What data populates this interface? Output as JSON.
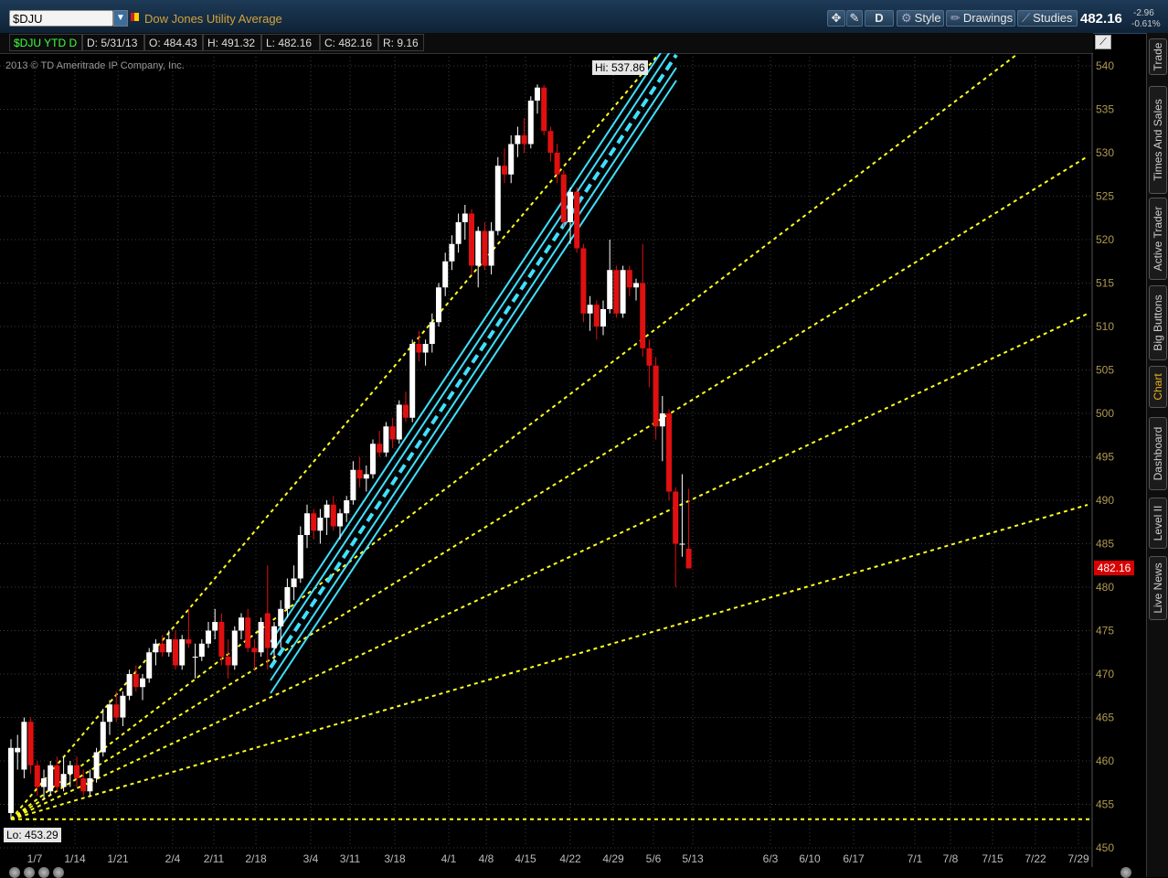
{
  "header": {
    "symbol": "$DJU",
    "description": "Dow Jones Utility Average",
    "style_label": "Style",
    "drawings_label": "Drawings",
    "studies_label": "Studies",
    "aggregation_label": "D",
    "last_price": "482.16",
    "net_change": "-2.96",
    "pct_change": "-0.61%"
  },
  "infobar": {
    "symbol_period": "$DJU YTD D",
    "date": "D: 5/31/13",
    "open": "O: 484.43",
    "high": "H: 491.32",
    "low": "L: 482.16",
    "close": "C: 482.16",
    "range": "R: 9.16"
  },
  "copyright": "2013 © TD Ameritrade IP Company, Inc.",
  "sidebar_tabs": [
    "Trade",
    "Times And Sales",
    "Active Trader",
    "Big Buttons",
    "Chart",
    "Dashboard",
    "Level II",
    "Live News"
  ],
  "active_tab": "Chart",
  "colors": {
    "background": "#000000",
    "up_candle": "#ffffff",
    "down_candle": "#e01010",
    "grid": "#3c3c3c",
    "fan_lines": "#ffff20",
    "channel": "#40e0ff",
    "price_axis_text": "#b09a50"
  },
  "chart_data": {
    "type": "candlestick",
    "symbol": "$DJU",
    "period": "YTD",
    "aggregation": "D",
    "y_range": [
      450,
      541
    ],
    "y_ticks": [
      450,
      455,
      460,
      465,
      470,
      475,
      480,
      485,
      490,
      495,
      500,
      505,
      510,
      515,
      520,
      525,
      530,
      535,
      540
    ],
    "x_ticks": [
      "1/7",
      "1/14",
      "1/21",
      "2/4",
      "2/11",
      "2/18",
      "3/4",
      "3/11",
      "3/18",
      "4/1",
      "4/8",
      "4/15",
      "4/22",
      "4/29",
      "5/6",
      "5/13",
      "6/3",
      "6/10",
      "6/17",
      "7/1",
      "7/8",
      "7/15",
      "7/22",
      "7/29"
    ],
    "hi_label": "Hi: 537.86",
    "lo_label": "Lo: 453.29",
    "last_price": "482.16",
    "hi": 537.86,
    "lo": 453.29,
    "candles": [
      {
        "date": "1/2",
        "o": 454.0,
        "h": 462.5,
        "l": 453.29,
        "c": 461.5
      },
      {
        "date": "1/3",
        "o": 461.0,
        "h": 463.0,
        "l": 459.0,
        "c": 461.5
      },
      {
        "date": "1/4",
        "o": 459.0,
        "h": 465.0,
        "l": 458.0,
        "c": 464.5
      },
      {
        "date": "1/7",
        "o": 464.5,
        "h": 465.0,
        "l": 458.5,
        "c": 459.5
      },
      {
        "date": "1/8",
        "o": 459.5,
        "h": 460.0,
        "l": 456.0,
        "c": 457.0
      },
      {
        "date": "1/9",
        "o": 457.0,
        "h": 459.0,
        "l": 455.5,
        "c": 458.0
      },
      {
        "date": "1/10",
        "o": 456.5,
        "h": 460.0,
        "l": 456.0,
        "c": 459.5
      },
      {
        "date": "1/11",
        "o": 459.5,
        "h": 460.5,
        "l": 456.5,
        "c": 457.0
      },
      {
        "date": "1/14",
        "o": 457.0,
        "h": 460.5,
        "l": 456.5,
        "c": 458.5
      },
      {
        "date": "1/15",
        "o": 458.5,
        "h": 460.0,
        "l": 457.0,
        "c": 459.5
      },
      {
        "date": "1/16",
        "o": 459.5,
        "h": 460.5,
        "l": 457.0,
        "c": 458.0
      },
      {
        "date": "1/17",
        "o": 458.0,
        "h": 459.0,
        "l": 456.0,
        "c": 456.5
      },
      {
        "date": "1/18",
        "o": 456.5,
        "h": 459.0,
        "l": 456.0,
        "c": 458.0
      },
      {
        "date": "1/22",
        "o": 458.0,
        "h": 461.5,
        "l": 457.5,
        "c": 461.0
      },
      {
        "date": "1/23",
        "o": 461.0,
        "h": 466.0,
        "l": 460.5,
        "c": 464.5
      },
      {
        "date": "1/24",
        "o": 464.5,
        "h": 467.0,
        "l": 463.0,
        "c": 466.5
      },
      {
        "date": "1/25",
        "o": 466.5,
        "h": 468.0,
        "l": 464.5,
        "c": 465.0
      },
      {
        "date": "1/28",
        "o": 465.0,
        "h": 468.0,
        "l": 464.0,
        "c": 467.5
      },
      {
        "date": "1/29",
        "o": 467.5,
        "h": 470.5,
        "l": 467.0,
        "c": 470.0
      },
      {
        "date": "1/30",
        "o": 470.0,
        "h": 471.0,
        "l": 468.0,
        "c": 468.5
      },
      {
        "date": "1/31",
        "o": 468.5,
        "h": 470.0,
        "l": 467.0,
        "c": 469.5
      },
      {
        "date": "2/1",
        "o": 469.5,
        "h": 473.0,
        "l": 469.0,
        "c": 472.5
      },
      {
        "date": "2/4",
        "o": 472.5,
        "h": 474.0,
        "l": 471.0,
        "c": 473.5
      },
      {
        "date": "2/5",
        "o": 473.5,
        "h": 474.5,
        "l": 472.0,
        "c": 472.5
      },
      {
        "date": "2/6",
        "o": 472.5,
        "h": 475.0,
        "l": 472.0,
        "c": 474.0
      },
      {
        "date": "2/7",
        "o": 474.0,
        "h": 475.0,
        "l": 470.5,
        "c": 471.0
      },
      {
        "date": "2/8",
        "o": 471.0,
        "h": 474.5,
        "l": 470.5,
        "c": 474.0
      },
      {
        "date": "2/11",
        "o": 474.0,
        "h": 477.5,
        "l": 473.0,
        "c": 473.5
      },
      {
        "date": "2/12",
        "o": 472.0,
        "h": 473.5,
        "l": 469.5,
        "c": 472.0
      },
      {
        "date": "2/13",
        "o": 472.0,
        "h": 474.0,
        "l": 471.5,
        "c": 473.5
      },
      {
        "date": "2/14",
        "o": 473.5,
        "h": 476.0,
        "l": 473.0,
        "c": 475.0
      },
      {
        "date": "2/15",
        "o": 475.0,
        "h": 477.5,
        "l": 474.0,
        "c": 476.0
      },
      {
        "date": "2/19",
        "o": 476.0,
        "h": 477.0,
        "l": 471.0,
        "c": 472.0
      },
      {
        "date": "2/20",
        "o": 472.0,
        "h": 474.0,
        "l": 469.5,
        "c": 471.0
      },
      {
        "date": "2/21",
        "o": 471.0,
        "h": 475.5,
        "l": 470.5,
        "c": 475.0
      },
      {
        "date": "2/22",
        "o": 475.0,
        "h": 477.0,
        "l": 474.0,
        "c": 476.5
      },
      {
        "date": "2/25",
        "o": 476.5,
        "h": 477.5,
        "l": 472.5,
        "c": 473.0
      },
      {
        "date": "2/26",
        "o": 473.0,
        "h": 474.0,
        "l": 470.5,
        "c": 472.5
      },
      {
        "date": "2/27",
        "o": 472.5,
        "h": 476.5,
        "l": 472.0,
        "c": 476.0
      },
      {
        "date": "2/28",
        "o": 477.0,
        "h": 482.5,
        "l": 470.5,
        "c": 473.0
      },
      {
        "date": "3/1",
        "o": 473.0,
        "h": 476.0,
        "l": 471.5,
        "c": 475.5
      },
      {
        "date": "3/4",
        "o": 475.5,
        "h": 478.5,
        "l": 473.0,
        "c": 477.5
      },
      {
        "date": "3/5",
        "o": 477.5,
        "h": 481.0,
        "l": 476.5,
        "c": 480.0
      },
      {
        "date": "3/6",
        "o": 480.0,
        "h": 482.5,
        "l": 478.5,
        "c": 481.0
      },
      {
        "date": "3/7",
        "o": 481.0,
        "h": 487.0,
        "l": 480.5,
        "c": 486.0
      },
      {
        "date": "3/8",
        "o": 486.0,
        "h": 489.5,
        "l": 484.5,
        "c": 488.5
      },
      {
        "date": "3/11",
        "o": 488.5,
        "h": 489.0,
        "l": 485.5,
        "c": 486.5
      },
      {
        "date": "3/12",
        "o": 486.5,
        "h": 489.0,
        "l": 485.0,
        "c": 488.0
      },
      {
        "date": "3/13",
        "o": 488.0,
        "h": 490.0,
        "l": 486.0,
        "c": 489.5
      },
      {
        "date": "3/14",
        "o": 489.5,
        "h": 490.5,
        "l": 486.5,
        "c": 487.0
      },
      {
        "date": "3/15",
        "o": 487.0,
        "h": 489.0,
        "l": 485.5,
        "c": 488.5
      },
      {
        "date": "3/18",
        "o": 488.5,
        "h": 490.5,
        "l": 487.5,
        "c": 490.0
      },
      {
        "date": "3/19",
        "o": 490.0,
        "h": 494.5,
        "l": 489.5,
        "c": 493.5
      },
      {
        "date": "3/20",
        "o": 493.5,
        "h": 495.0,
        "l": 491.5,
        "c": 492.5
      },
      {
        "date": "3/21",
        "o": 492.5,
        "h": 494.0,
        "l": 491.0,
        "c": 493.0
      },
      {
        "date": "3/22",
        "o": 493.0,
        "h": 497.0,
        "l": 492.5,
        "c": 496.5
      },
      {
        "date": "3/25",
        "o": 496.5,
        "h": 498.0,
        "l": 495.0,
        "c": 495.5
      },
      {
        "date": "3/26",
        "o": 495.5,
        "h": 499.0,
        "l": 495.0,
        "c": 498.5
      },
      {
        "date": "3/27",
        "o": 498.5,
        "h": 499.5,
        "l": 496.0,
        "c": 497.0
      },
      {
        "date": "3/28",
        "o": 497.0,
        "h": 501.5,
        "l": 496.5,
        "c": 501.0
      },
      {
        "date": "4/1",
        "o": 501.0,
        "h": 502.5,
        "l": 499.0,
        "c": 499.5
      },
      {
        "date": "4/2",
        "o": 499.5,
        "h": 508.5,
        "l": 499.0,
        "c": 508.0
      },
      {
        "date": "4/3",
        "o": 508.0,
        "h": 509.5,
        "l": 506.0,
        "c": 507.0
      },
      {
        "date": "4/4",
        "o": 507.0,
        "h": 508.5,
        "l": 505.5,
        "c": 508.0
      },
      {
        "date": "4/5",
        "o": 508.0,
        "h": 511.5,
        "l": 507.0,
        "c": 510.5
      },
      {
        "date": "4/8",
        "o": 510.5,
        "h": 515.0,
        "l": 510.0,
        "c": 514.5
      },
      {
        "date": "4/9",
        "o": 514.5,
        "h": 518.5,
        "l": 513.5,
        "c": 517.5
      },
      {
        "date": "4/10",
        "o": 517.5,
        "h": 520.5,
        "l": 516.5,
        "c": 519.5
      },
      {
        "date": "4/11",
        "o": 519.5,
        "h": 523.0,
        "l": 518.5,
        "c": 522.0
      },
      {
        "date": "4/12",
        "o": 522.0,
        "h": 524.0,
        "l": 520.0,
        "c": 523.0
      },
      {
        "date": "4/15",
        "o": 523.0,
        "h": 523.5,
        "l": 516.0,
        "c": 517.0
      },
      {
        "date": "4/16",
        "o": 517.0,
        "h": 521.5,
        "l": 514.5,
        "c": 521.0
      },
      {
        "date": "4/17",
        "o": 521.0,
        "h": 522.0,
        "l": 516.5,
        "c": 517.0
      },
      {
        "date": "4/18",
        "o": 517.0,
        "h": 522.0,
        "l": 516.0,
        "c": 521.0
      },
      {
        "date": "4/19",
        "o": 521.0,
        "h": 529.5,
        "l": 520.5,
        "c": 528.5
      },
      {
        "date": "4/22",
        "o": 528.5,
        "h": 530.5,
        "l": 526.5,
        "c": 527.5
      },
      {
        "date": "4/23",
        "o": 527.5,
        "h": 532.0,
        "l": 526.5,
        "c": 531.0
      },
      {
        "date": "4/24",
        "o": 531.0,
        "h": 533.0,
        "l": 529.5,
        "c": 532.0
      },
      {
        "date": "4/25",
        "o": 532.0,
        "h": 534.0,
        "l": 530.0,
        "c": 531.0
      },
      {
        "date": "4/26",
        "o": 531.0,
        "h": 536.5,
        "l": 530.5,
        "c": 536.0
      },
      {
        "date": "4/29",
        "o": 536.0,
        "h": 537.86,
        "l": 534.5,
        "c": 537.5
      },
      {
        "date": "4/30",
        "o": 537.5,
        "h": 537.8,
        "l": 532.0,
        "c": 532.5
      },
      {
        "date": "5/1",
        "o": 532.5,
        "h": 533.0,
        "l": 529.0,
        "c": 530.0
      },
      {
        "date": "5/2",
        "o": 530.0,
        "h": 531.0,
        "l": 526.5,
        "c": 527.5
      },
      {
        "date": "5/3",
        "o": 527.5,
        "h": 528.0,
        "l": 521.5,
        "c": 522.0
      },
      {
        "date": "5/6",
        "o": 522.0,
        "h": 526.0,
        "l": 519.5,
        "c": 525.5
      },
      {
        "date": "5/7",
        "o": 525.5,
        "h": 526.0,
        "l": 518.5,
        "c": 519.0
      },
      {
        "date": "5/8",
        "o": 519.0,
        "h": 519.5,
        "l": 510.5,
        "c": 511.5
      },
      {
        "date": "5/9",
        "o": 511.5,
        "h": 513.5,
        "l": 509.5,
        "c": 512.5
      },
      {
        "date": "5/10",
        "o": 512.5,
        "h": 513.0,
        "l": 508.5,
        "c": 510.0
      },
      {
        "date": "5/13",
        "o": 510.0,
        "h": 513.0,
        "l": 509.0,
        "c": 512.0
      },
      {
        "date": "5/14",
        "o": 512.0,
        "h": 520.0,
        "l": 511.5,
        "c": 516.5
      },
      {
        "date": "5/15",
        "o": 516.5,
        "h": 517.0,
        "l": 511.0,
        "c": 511.5
      },
      {
        "date": "5/16",
        "o": 511.5,
        "h": 517.0,
        "l": 511.0,
        "c": 516.5
      },
      {
        "date": "5/17",
        "o": 516.5,
        "h": 517.0,
        "l": 513.5,
        "c": 514.5
      },
      {
        "date": "5/20",
        "o": 514.5,
        "h": 515.5,
        "l": 513.0,
        "c": 515.0
      },
      {
        "date": "5/21",
        "o": 515.0,
        "h": 519.5,
        "l": 506.5,
        "c": 507.5
      },
      {
        "date": "5/22",
        "o": 507.5,
        "h": 508.5,
        "l": 503.0,
        "c": 505.5
      },
      {
        "date": "5/23",
        "o": 505.5,
        "h": 506.5,
        "l": 497.0,
        "c": 498.5
      },
      {
        "date": "5/24",
        "o": 498.5,
        "h": 502.0,
        "l": 494.5,
        "c": 500.0
      },
      {
        "date": "5/28",
        "o": 500.0,
        "h": 500.5,
        "l": 490.0,
        "c": 491.0
      },
      {
        "date": "5/29",
        "o": 491.0,
        "h": 491.5,
        "l": 480.0,
        "c": 485.0
      },
      {
        "date": "5/30",
        "o": 485.0,
        "h": 493.0,
        "l": 483.5,
        "c": 485.0
      },
      {
        "date": "5/31",
        "o": 484.43,
        "h": 491.32,
        "l": 482.16,
        "c": 482.16
      }
    ]
  }
}
